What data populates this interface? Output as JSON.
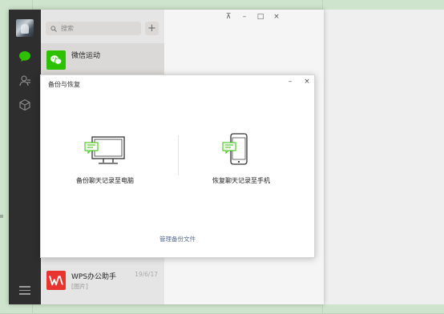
{
  "wechat": {
    "search": {
      "placeholder": "搜索"
    },
    "add_label": "+",
    "chats": [
      {
        "name": "微信运动",
        "sub": "",
        "time": ""
      },
      {
        "name": "WPS办公助手",
        "sub": "[图片]",
        "time": "19/6/17"
      }
    ],
    "window_controls": {
      "pin": "⊼",
      "minimize": "–",
      "maximize": "□",
      "close": "×"
    }
  },
  "dialog": {
    "title": "备份与恢复",
    "minimize": "–",
    "close": "×",
    "backup_label": "备份聊天记录至电脑",
    "restore_label": "恢复聊天记录至手机",
    "manage_link": "管理备份文件"
  },
  "colors": {
    "accent_green": "#2dc100",
    "wps_red": "#e8342f",
    "link_blue": "#576b95"
  }
}
